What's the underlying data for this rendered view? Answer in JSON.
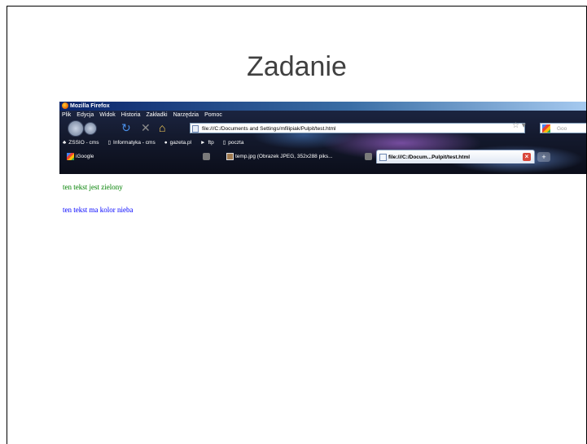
{
  "slide": {
    "title": "Zadanie"
  },
  "browser": {
    "window_title": "Mozilla Firefox",
    "menu": [
      "Plik",
      "Edycja",
      "Widok",
      "Historia",
      "Zakładki",
      "Narzędzia",
      "Pomoc"
    ],
    "url": "file:///C:/Documents and Settings/mfilipiak/Pulpit/test.html",
    "search_placeholder": "Goo",
    "bookmarks": [
      "ZSSIO - cms",
      "Informatyka - cms",
      "gazeta.pl",
      "ftp",
      "poczta"
    ],
    "tabs": [
      {
        "label": "iGoogle"
      },
      {
        "label": "temp.jpg (Obrazek JPEG, 352x288 piks..."
      },
      {
        "label": "file:///C:/Docum...Pulpit/test.html"
      }
    ],
    "new_tab_label": "+"
  },
  "page": {
    "green_text": "ten tekst jest zielony",
    "blue_text": "ten tekst ma kolor nieba"
  },
  "colors": {
    "green_text": "#008000",
    "blue_text": "#0000ff"
  }
}
